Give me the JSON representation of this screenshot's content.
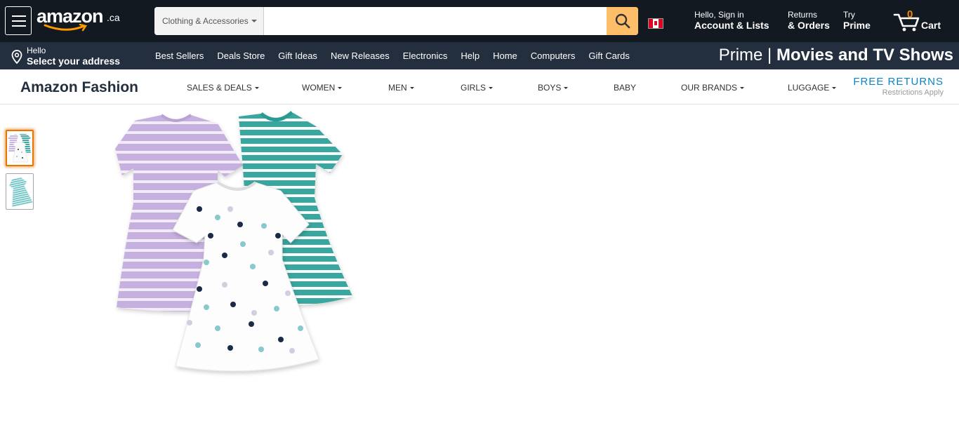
{
  "header": {
    "logo_text": "amazon",
    "logo_tld": ".ca",
    "search": {
      "department": "Clothing & Accessories",
      "placeholder": "",
      "value": ""
    },
    "account": {
      "line1": "Hello, Sign in",
      "line2": "Account & Lists"
    },
    "returns": {
      "line1": "Returns",
      "line2": "& Orders"
    },
    "prime": {
      "line1": "Try",
      "line2": "Prime"
    },
    "cart": {
      "count": "0",
      "label": "Cart"
    }
  },
  "subnav": {
    "address": {
      "line1": "Hello",
      "line2": "Select your address"
    },
    "links": [
      "Best Sellers",
      "Deals Store",
      "Gift Ideas",
      "New Releases",
      "Electronics",
      "Help",
      "Home",
      "Computers",
      "Gift Cards"
    ],
    "banner": {
      "prefix": "Prime",
      "separator": "|",
      "bold": "Movies and TV Shows"
    }
  },
  "fashion": {
    "title": "Amazon Fashion",
    "categories": [
      "SALES & DEALS",
      "WOMEN",
      "MEN",
      "GIRLS",
      "BOYS",
      "BABY",
      "OUR BRANDS",
      "LUGGAGE"
    ],
    "free_returns": {
      "title": "FREE RETURNS",
      "subtitle": "Restrictions Apply"
    }
  },
  "product": {
    "thumbnails": [
      "three-dresses",
      "teal-dress"
    ],
    "selected_thumbnail": 0
  },
  "colors": {
    "nav_dark": "#131921",
    "nav_sub": "#232f3e",
    "search_button": "#febd69",
    "cart_count": "#f08804",
    "link_blue": "#0a82c8",
    "lavender": "#c9b3e3",
    "teal": "#3aa9a3"
  }
}
